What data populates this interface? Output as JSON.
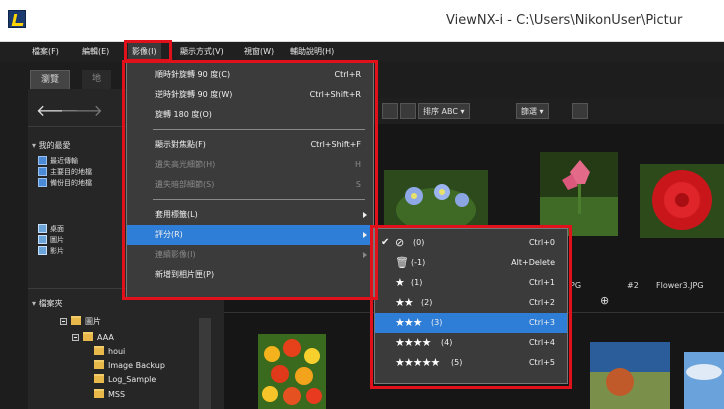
{
  "window": {
    "title": "ViewNX-i - C:\\Users\\NikonUser\\Pictur"
  },
  "menubar": {
    "items": [
      "檔案(F)",
      "編輯(E)",
      "影像(I)",
      "顯示方式(V)",
      "視窗(W)",
      "輔助說明(H)"
    ]
  },
  "tabs": [
    "瀏覽",
    "地"
  ],
  "left_panel": {
    "favorites_title": "我的最愛",
    "favorites": [
      "最近傳輸",
      "主要目的地檔",
      "備份目的地檔"
    ],
    "locations": [
      "桌面",
      "圖片",
      "影片"
    ],
    "folders_title": "檔案夾",
    "tree": [
      "圖片",
      "AAA",
      "houi",
      "Image Backup",
      "Log_Sample",
      "MSS"
    ]
  },
  "toolbar": {
    "sort_label": "排序 ABC",
    "filter_label": "篩選"
  },
  "thumbnails": {
    "labels": [
      "PG",
      "#2",
      "Flower3.JPG"
    ]
  },
  "image_menu": {
    "items": [
      {
        "label": "順時針旋轉 90 度(C)",
        "shortcut": "Ctrl+R",
        "disabled": false
      },
      {
        "label": "逆時針旋轉 90 度(W)",
        "shortcut": "Ctrl+Shift+R",
        "disabled": false
      },
      {
        "label": "旋轉 180 度(O)",
        "shortcut": "",
        "disabled": false
      },
      {
        "label": "顯示對焦點(F)",
        "shortcut": "Ctrl+Shift+F",
        "disabled": false
      },
      {
        "label": "遺失高光細節(H)",
        "shortcut": "H",
        "disabled": true
      },
      {
        "label": "遺失暗部細節(S)",
        "shortcut": "S",
        "disabled": true
      },
      {
        "label": "套用標籤(L)",
        "shortcut": "",
        "disabled": false
      },
      {
        "label": "評分(R)",
        "shortcut": "",
        "disabled": false
      },
      {
        "label": "連續影像(I)",
        "shortcut": "",
        "disabled": true
      },
      {
        "label": "新增到相片匣(P)",
        "shortcut": "",
        "disabled": false
      }
    ]
  },
  "rating_menu": {
    "items": [
      {
        "label": "(0)",
        "shortcut": "Ctrl+0"
      },
      {
        "label": "(-1)",
        "shortcut": "Alt+Delete"
      },
      {
        "label": "(1)",
        "shortcut": "Ctrl+1"
      },
      {
        "label": "(2)",
        "shortcut": "Ctrl+2"
      },
      {
        "label": "(3)",
        "shortcut": "Ctrl+3"
      },
      {
        "label": "(4)",
        "shortcut": "Ctrl+4"
      },
      {
        "label": "(5)",
        "shortcut": "Ctrl+5"
      }
    ],
    "stars": [
      "",
      "",
      "★",
      "★★",
      "★★★",
      "★★★★",
      "★★★★★"
    ],
    "highlighted_index": 4,
    "checked_index": 0
  },
  "colors": {
    "highlight": "#2e7dd6",
    "callout": "#e0111b",
    "menu_bg": "#3b3b3b"
  }
}
